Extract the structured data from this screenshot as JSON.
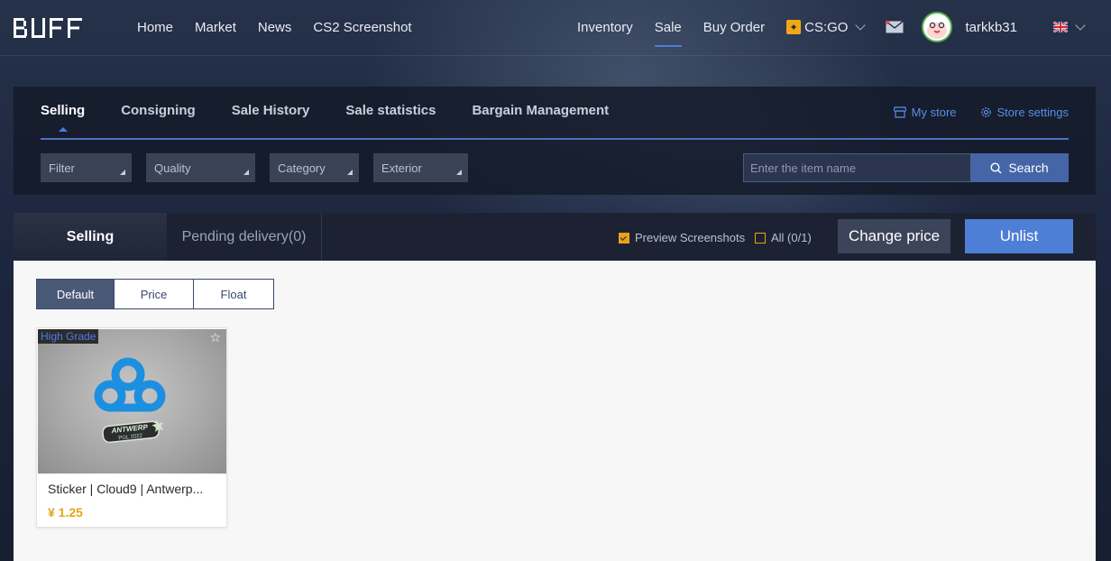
{
  "brand": {
    "logo_text": "BUFF"
  },
  "nav": {
    "left": [
      "Home",
      "Market",
      "News",
      "CS2 Screenshot"
    ],
    "right": [
      "Inventory",
      "Sale",
      "Buy Order"
    ],
    "active": "Sale",
    "game": "CS:GO",
    "username": "tarkkb31"
  },
  "panel": {
    "tabs": [
      "Selling",
      "Consigning",
      "Sale History",
      "Sale statistics",
      "Bargain Management"
    ],
    "active_tab": "Selling",
    "store_links": {
      "my_store": "My store",
      "store_settings": "Store settings"
    },
    "filters": [
      "Filter",
      "Quality",
      "Category",
      "Exterior"
    ],
    "search": {
      "placeholder": "Enter the item name",
      "button": "Search"
    }
  },
  "subbar": {
    "selling": "Selling",
    "pending": "Pending delivery(0)",
    "preview_screenshots": "Preview Screenshots",
    "all": "All (0/1)",
    "change_price": "Change price",
    "unlist": "Unlist"
  },
  "sorts": [
    "Default",
    "Price",
    "Float"
  ],
  "items": [
    {
      "grade": "High Grade",
      "name": "Sticker | Cloud9 | Antwerp...",
      "price": "¥ 1.25",
      "sticker_text": "ANTWERP",
      "sticker_sub": "PGL 2022"
    }
  ],
  "colors": {
    "accent": "#4f7ad9",
    "price": "#e6a31a",
    "grade": "#4f7ae8"
  }
}
